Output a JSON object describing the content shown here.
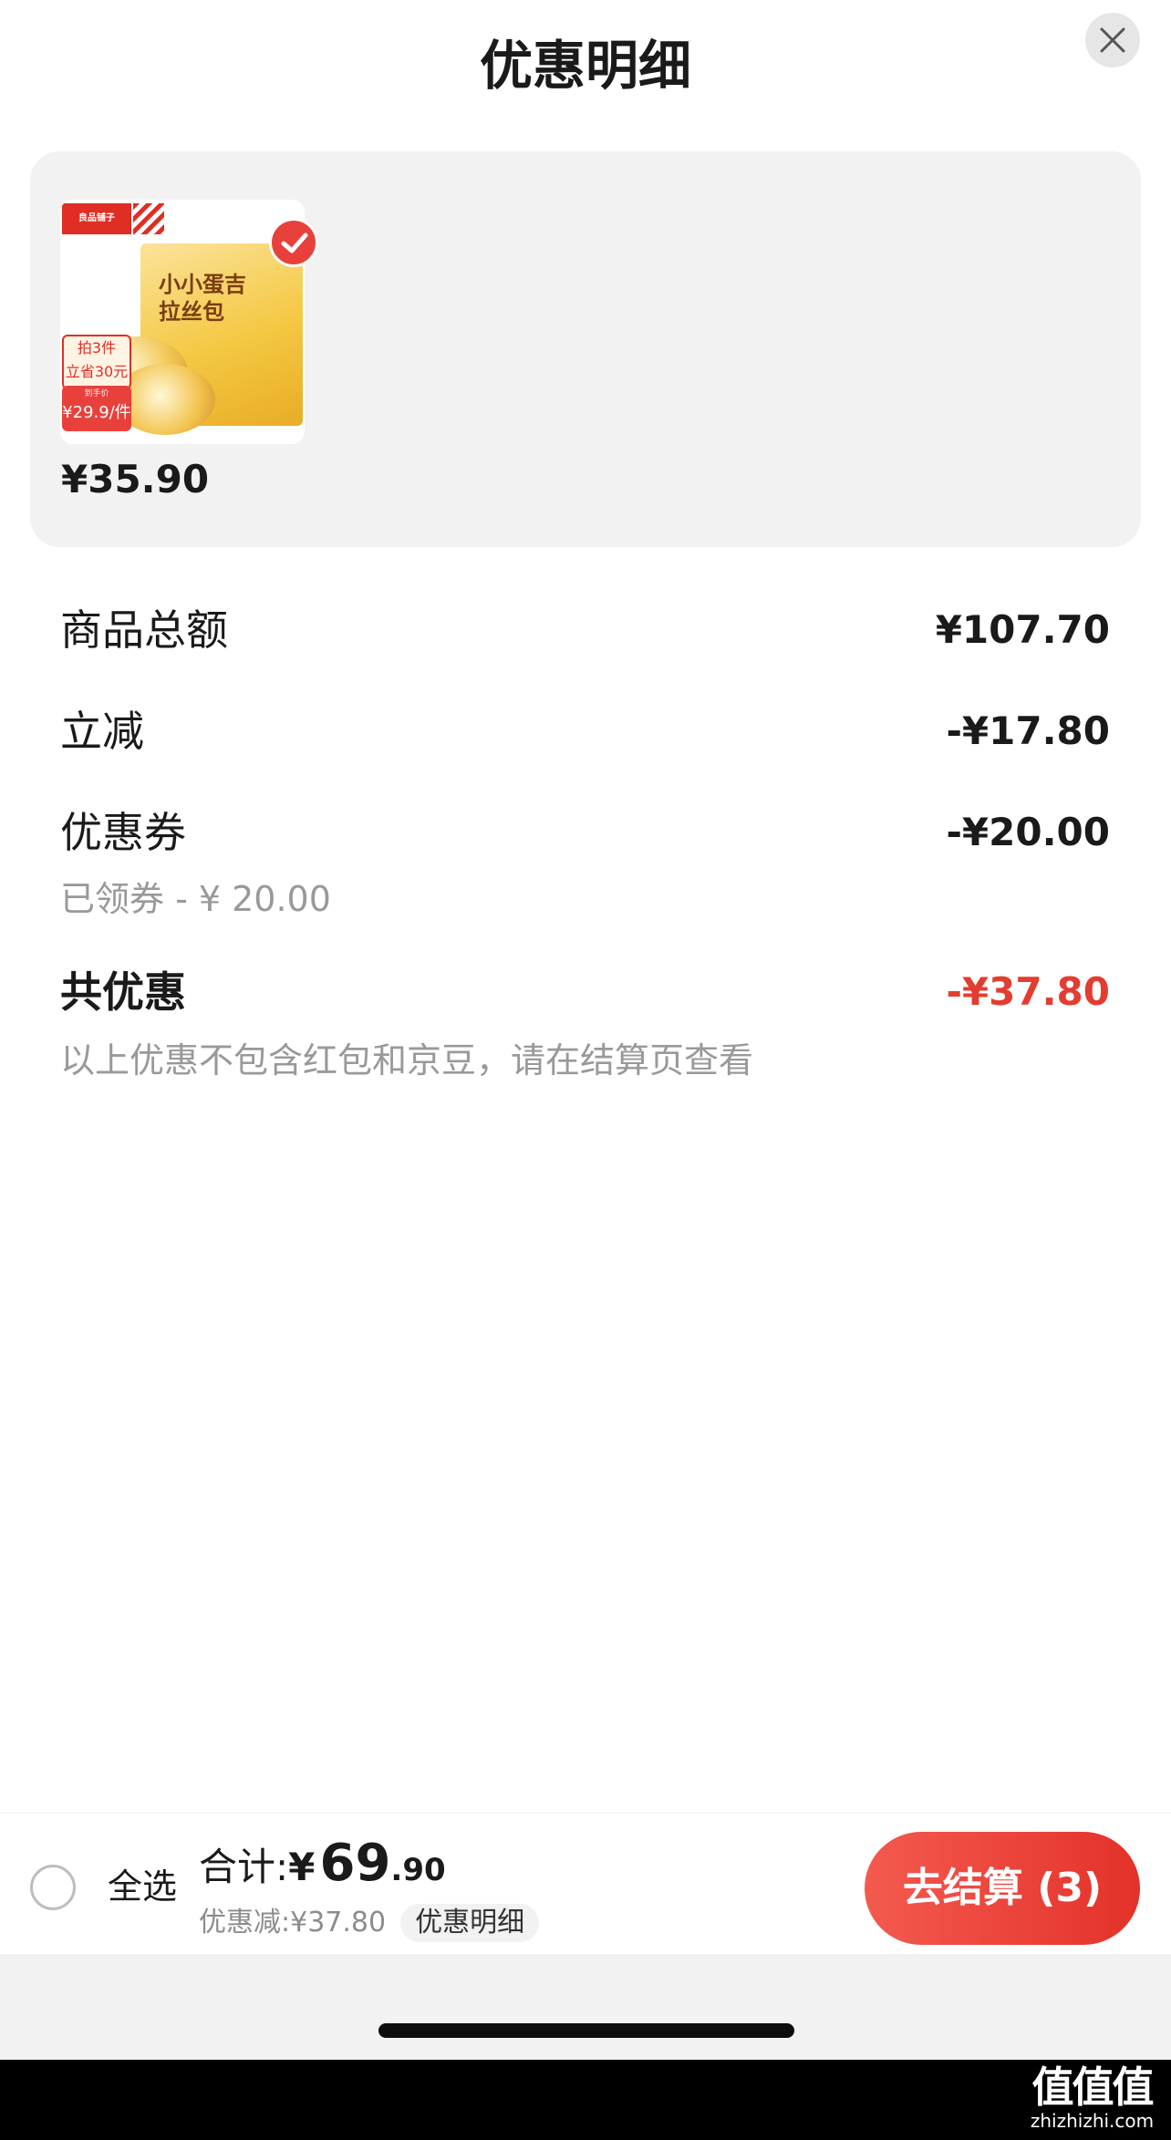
{
  "header": {
    "title": "优惠明细",
    "close_icon": "close-icon"
  },
  "product": {
    "thumbnail": {
      "brand": "良品铺子",
      "box_title": "小小蛋吉\n拉丝包",
      "promo": "拍3件\n立省30元",
      "price_label": "到手价",
      "price_value": "¥29.9/件"
    },
    "selected": true,
    "price": "¥35.90"
  },
  "breakdown": {
    "subtotal": {
      "label": "商品总额",
      "value": "¥107.70"
    },
    "instant_discount": {
      "label": "立减",
      "value": "-¥17.80"
    },
    "coupon": {
      "label": "优惠券",
      "value": "-¥20.00",
      "sub": "已领券 - ¥ 20.00"
    },
    "total_discount": {
      "label": "共优惠",
      "value": "-¥37.80",
      "note": "以上优惠不包含红包和京豆，请在结算页查看"
    }
  },
  "footer": {
    "select_all": "全选",
    "total_label": "合计:",
    "total_symbol": "¥",
    "total_int": "69",
    "total_dec": ".90",
    "discount_text": "优惠减:¥37.80",
    "detail_link": "优惠明细",
    "checkout": "去结算 (3)"
  },
  "watermark": {
    "main": "值值值",
    "sub": "zhizhizhi.com"
  },
  "colors": {
    "accent_red": "#e23d30",
    "button_red": "#e3322a",
    "card_bg": "#f2f2f2"
  }
}
